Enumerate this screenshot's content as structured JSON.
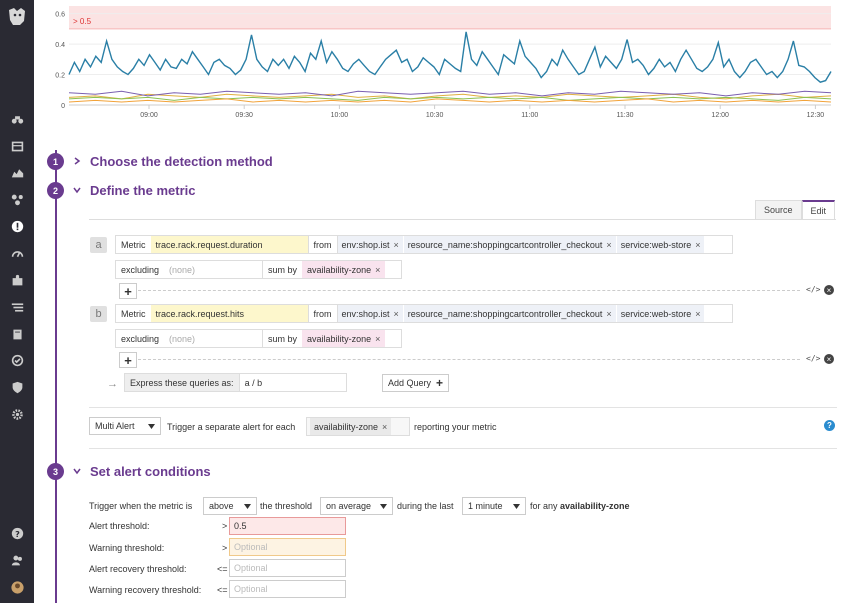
{
  "chart_data": {
    "type": "line",
    "title": "",
    "xlabel": "",
    "ylabel": "",
    "ylim": [
      0,
      0.65
    ],
    "y_ticks": [
      "0",
      "0.2",
      "0.4",
      "0.6"
    ],
    "x_ticks": [
      "09:00",
      "09:30",
      "10:00",
      "10:30",
      "11:00",
      "11:30",
      "12:00",
      "12:30"
    ],
    "threshold_label": "> 0.5",
    "threshold_value": 0.5,
    "grid": true,
    "colors": {
      "main": "#2a7fa6",
      "threshold": "#fbe3e3",
      "threshold_text": "#d33"
    },
    "series": [
      {
        "color": "#2a7fa6",
        "values": [
          0.2,
          0.28,
          0.22,
          0.3,
          0.25,
          0.32,
          0.28,
          0.42,
          0.3,
          0.25,
          0.22,
          0.2,
          0.24,
          0.3,
          0.26,
          0.33,
          0.28,
          0.23,
          0.3,
          0.25,
          0.24,
          0.3,
          0.27,
          0.35,
          0.3,
          0.25,
          0.2,
          0.28,
          0.3,
          0.26,
          0.24,
          0.2,
          0.23,
          0.3,
          0.46,
          0.3,
          0.25,
          0.22,
          0.3,
          0.26,
          0.3,
          0.24,
          0.32,
          0.28,
          0.22,
          0.34,
          0.3,
          0.42,
          0.28,
          0.35,
          0.3,
          0.24,
          0.22,
          0.27,
          0.3,
          0.26,
          0.22,
          0.2,
          0.25,
          0.3,
          0.33,
          0.36,
          0.28,
          0.3,
          0.22,
          0.25,
          0.31,
          0.28,
          0.25,
          0.2,
          0.3,
          0.27,
          0.24,
          0.22,
          0.48,
          0.3,
          0.26,
          0.35,
          0.3,
          0.25,
          0.2,
          0.33,
          0.3,
          0.27,
          0.42,
          0.32,
          0.28,
          0.24,
          0.18,
          0.22,
          0.3,
          0.26,
          0.36,
          0.3,
          0.25,
          0.2,
          0.22,
          0.3,
          0.38,
          0.25,
          0.32,
          0.28,
          0.24,
          0.3,
          0.43,
          0.28,
          0.3,
          0.26,
          0.2,
          0.24,
          0.3,
          0.25,
          0.28,
          0.22,
          0.3,
          0.36,
          0.3,
          0.24,
          0.22,
          0.25,
          0.3,
          0.41,
          0.25,
          0.3,
          0.22,
          0.18,
          0.22,
          0.28,
          0.3,
          0.25,
          0.2,
          0.22,
          0.18,
          0.22,
          0.3,
          0.42,
          0.26,
          0.25,
          0.22,
          0.18,
          0.15,
          0.16,
          0.22
        ]
      },
      {
        "color": "#e0b040",
        "values": [
          0.05,
          0.06,
          0.04,
          0.07,
          0.06,
          0.05,
          0.07,
          0.06,
          0.05,
          0.06,
          0.07,
          0.05,
          0.06,
          0.04,
          0.06,
          0.07,
          0.05,
          0.06,
          0.05,
          0.07,
          0.06,
          0.05,
          0.06,
          0.07,
          0.05,
          0.04,
          0.06,
          0.07,
          0.05,
          0.06
        ]
      },
      {
        "color": "#7a5fb0",
        "values": [
          0.08,
          0.07,
          0.09,
          0.06,
          0.08,
          0.07,
          0.09,
          0.08,
          0.07,
          0.08,
          0.06,
          0.09,
          0.08,
          0.07,
          0.08,
          0.09,
          0.07,
          0.08,
          0.06,
          0.08,
          0.07,
          0.09,
          0.08,
          0.07,
          0.08,
          0.06,
          0.08,
          0.07,
          0.09,
          0.08
        ]
      },
      {
        "color": "#8cc152",
        "values": [
          0.04,
          0.05,
          0.04,
          0.05,
          0.03,
          0.05,
          0.04,
          0.05,
          0.04,
          0.05,
          0.04,
          0.03,
          0.05,
          0.04,
          0.05,
          0.04,
          0.05,
          0.04,
          0.05,
          0.03,
          0.04,
          0.05,
          0.04,
          0.05,
          0.04,
          0.05,
          0.04,
          0.03,
          0.05,
          0.04
        ]
      },
      {
        "color": "#f2a33a",
        "values": [
          0.02,
          0.03,
          0.02,
          0.03,
          0.02,
          0.03,
          0.04,
          0.02,
          0.03,
          0.02,
          0.03,
          0.02,
          0.03,
          0.02,
          0.04,
          0.03,
          0.02,
          0.03,
          0.02,
          0.03,
          0.02,
          0.03,
          0.04,
          0.02,
          0.03,
          0.02,
          0.03,
          0.02,
          0.03,
          0.02
        ]
      }
    ]
  },
  "steps": [
    {
      "number": "1",
      "title": "Choose the detection method"
    },
    {
      "number": "2",
      "title": "Define the metric"
    },
    {
      "number": "3",
      "title": "Set alert conditions"
    }
  ],
  "tabs": {
    "source": "Source",
    "edit": "Edit"
  },
  "query_a": {
    "letter": "a",
    "metric_label": "Metric",
    "metric": "trace.rack.request.duration",
    "from_label": "from",
    "tags": [
      "env:shop.ist",
      "resource_name:shoppingcartcontroller_checkout",
      "service:web-store"
    ],
    "excluding_label": "excluding",
    "excluding_value": "(none)",
    "sumby_label": "sum by",
    "sumby_value": "availability-zone"
  },
  "query_b": {
    "letter": "b",
    "metric_label": "Metric",
    "metric": "trace.rack.request.hits",
    "from_label": "from",
    "tags": [
      "env:shop.ist",
      "resource_name:shoppingcartcontroller_checkout",
      "service:web-store"
    ],
    "excluding_label": "excluding",
    "excluding_value": "(none)",
    "sumby_label": "sum by",
    "sumby_value": "availability-zone"
  },
  "expression": {
    "arrow": "→",
    "label": "Express these queries as:",
    "value": "a / b",
    "add_query": "Add Query"
  },
  "multi_alert": {
    "select": "Multi Alert",
    "text": "Trigger a separate alert for each",
    "tag": "availability-zone",
    "suffix": "reporting your metric"
  },
  "conditions": {
    "trigger_prefix": "Trigger when the metric is",
    "comparator": "above",
    "threshold_text": "the threshold",
    "aggregation": "on average",
    "during": "during the last",
    "window": "1 minute",
    "for_any": "for any",
    "group": "availability-zone",
    "rows": [
      {
        "label": "Alert threshold:",
        "op": ">",
        "value": "0.5",
        "placeholder": ""
      },
      {
        "label": "Warning threshold:",
        "op": ">",
        "value": "",
        "placeholder": "Optional"
      },
      {
        "label": "Alert recovery threshold:",
        "op": "<=",
        "value": "",
        "placeholder": "Optional"
      },
      {
        "label": "Warning recovery threshold:",
        "op": "<=",
        "value": "",
        "placeholder": "Optional"
      }
    ]
  },
  "x_symbol": "×",
  "plus_symbol": "+",
  "code_symbol": "</>",
  "help_symbol": "?"
}
